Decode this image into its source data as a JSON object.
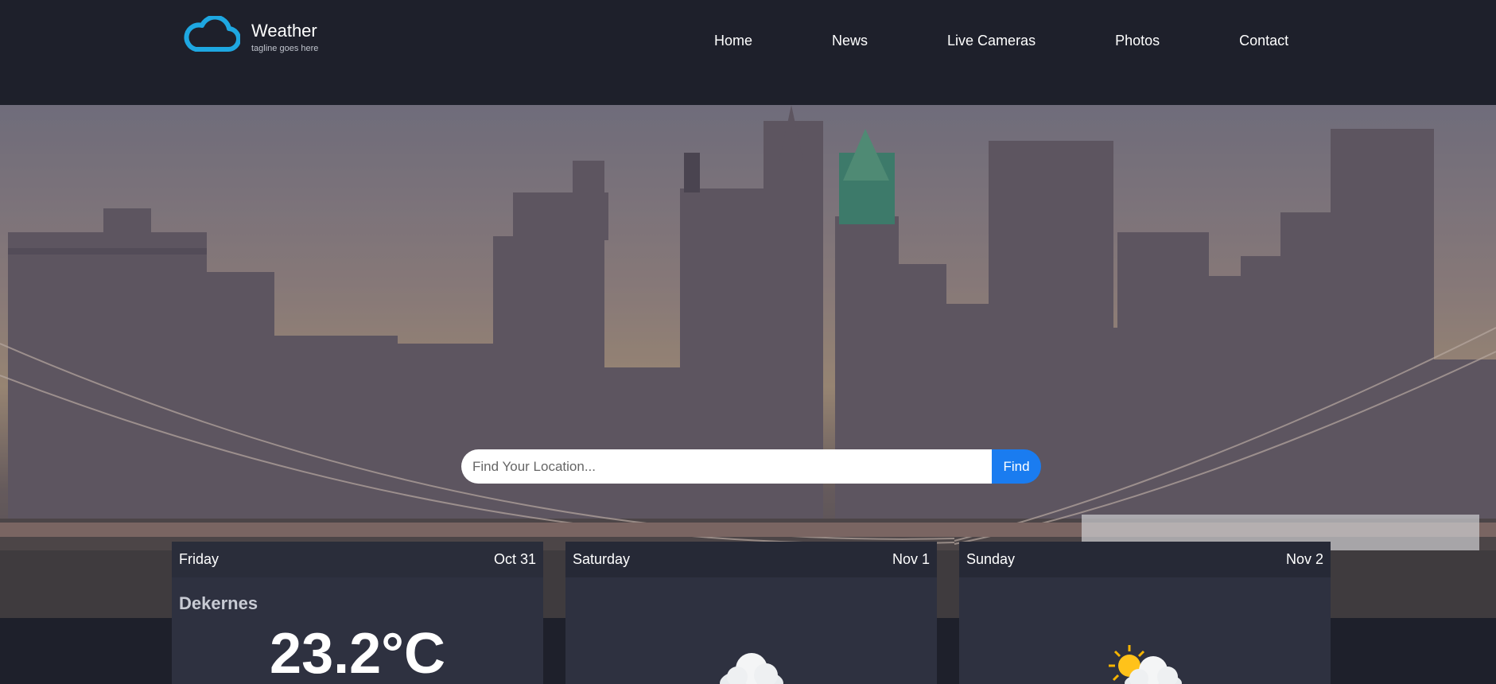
{
  "brand": {
    "title": "Weather",
    "tagline": "tagline goes here"
  },
  "nav": {
    "items": [
      "Home",
      "News",
      "Live Cameras",
      "Photos",
      "Contact"
    ]
  },
  "search": {
    "placeholder": "Find Your Location...",
    "button_label": "Find"
  },
  "forecast": [
    {
      "day": "Friday",
      "date": "Oct 31",
      "location": "Dekernes",
      "temperature": "23.2°C",
      "icon": "cloud-icon"
    },
    {
      "day": "Saturday",
      "date": "Nov 1",
      "icon": "cloud-icon"
    },
    {
      "day": "Sunday",
      "date": "Nov 2",
      "icon": "sun-cloud-icon"
    }
  ],
  "colors": {
    "background": "#1e202b",
    "accent": "#1a7cf0",
    "card": "#2e3140",
    "logo": "#1ea7e1"
  }
}
